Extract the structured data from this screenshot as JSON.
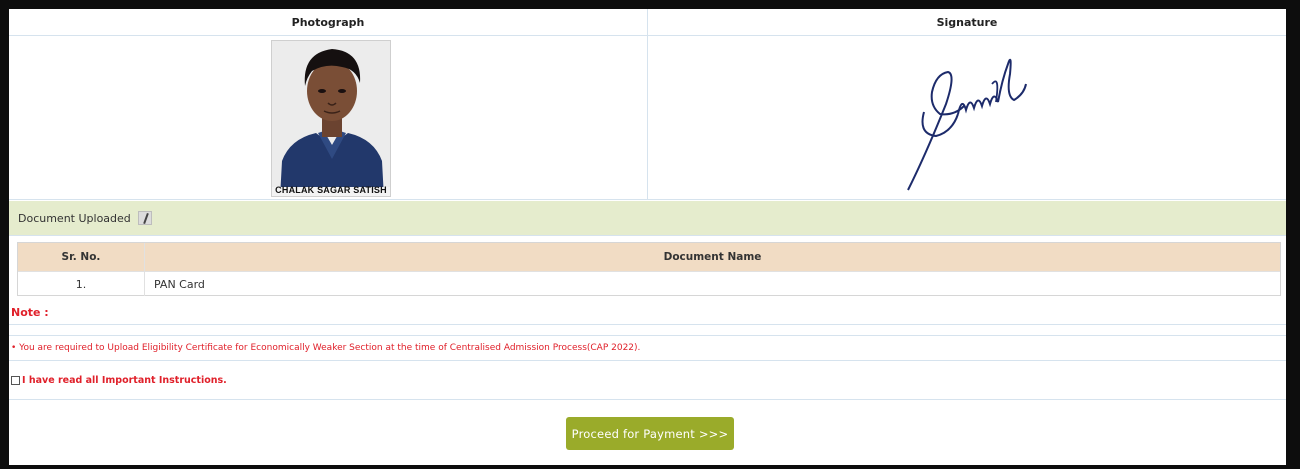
{
  "upload": {
    "photo_header": "Photograph",
    "signature_header": "Signature",
    "photo_caption": "CHALAK SAGAR SATISH"
  },
  "documents": {
    "section_label": "Document Uploaded",
    "columns": [
      "Sr. No.",
      "Document Name"
    ],
    "rows": [
      {
        "sr": "1.",
        "name": "PAN Card"
      }
    ]
  },
  "note": {
    "title": "Note :",
    "text": "• You are required to Upload Eligibility Certificate for Economically Weaker Section at the time of Centralised Admission Process(CAP 2022)."
  },
  "instructions": {
    "checkbox_label": "I have read all Important Instructions.",
    "checked": false
  },
  "actions": {
    "proceed_label": "Proceed for Payment >>>"
  },
  "colors": {
    "accent_green": "#9aab2a",
    "band_green": "#e5eccd",
    "table_head": "#f1dcc4",
    "note_red": "#e0202a"
  },
  "icons": {
    "edit": "pencil-edit-icon"
  }
}
